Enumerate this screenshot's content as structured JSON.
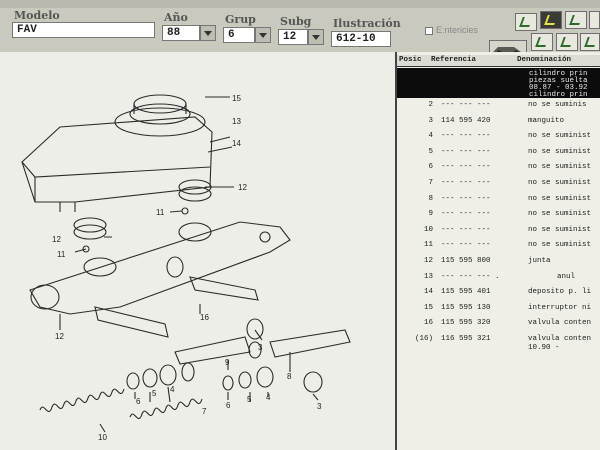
{
  "toolbar": {
    "fields": [
      {
        "key": "modelo",
        "label": "Modelo",
        "value": "FAV"
      },
      {
        "key": "ano",
        "label": "Año",
        "value": "88"
      },
      {
        "key": "grup",
        "label": "Grup",
        "value": "6"
      },
      {
        "key": "subg",
        "label": "Subg",
        "value": "12"
      },
      {
        "key": "ilustracion",
        "label": "Ilustración",
        "value": "612-10"
      }
    ],
    "checkbox_label": "E:ntericies"
  },
  "diagram": {
    "callouts": [
      "15",
      "13",
      "14",
      "12",
      "11",
      "12",
      "11",
      "16",
      "12",
      "9",
      "3",
      "8",
      "7",
      "5",
      "4",
      "6",
      "10",
      "6",
      "5",
      "4",
      "3"
    ]
  },
  "parts_table": {
    "headers": {
      "pos": "Posic",
      "ref": "Referencia",
      "den": "Denominación"
    },
    "highlighted_lines": [
      "cilindro prin",
      "piezas suelta",
      "08.87 - 03.92",
      "cilindro prin"
    ],
    "rows": [
      {
        "pos": "2",
        "ref": "--- --- ---",
        "den": "no se suminis"
      },
      {
        "pos": "3",
        "ref": "114 595 420",
        "den": "manguito"
      },
      {
        "pos": "4",
        "ref": "--- --- ---",
        "den": "no se suminist"
      },
      {
        "pos": "5",
        "ref": "--- --- ---",
        "den": "no se suminist"
      },
      {
        "pos": "6",
        "ref": "--- --- ---",
        "den": "no se suminist"
      },
      {
        "pos": "7",
        "ref": "--- --- ---",
        "den": "no se suminist"
      },
      {
        "pos": "8",
        "ref": "--- --- ---",
        "den": "no se suminist"
      },
      {
        "pos": "9",
        "ref": "--- --- ---",
        "den": "no se suminist"
      },
      {
        "pos": "10",
        "ref": "--- --- ---",
        "den": "no se suminist"
      },
      {
        "pos": "11",
        "ref": "--- --- ---",
        "den": "no se suminist"
      },
      {
        "pos": "12",
        "ref": "115 595 800",
        "den": "junta"
      },
      {
        "pos": "13",
        "ref": "--- --- --- .",
        "den": "anul"
      },
      {
        "pos": "14",
        "ref": "115 595 401",
        "den": "deposito p. li"
      },
      {
        "pos": "15",
        "ref": "115 595 130",
        "den": "interruptor ni"
      },
      {
        "pos": "16",
        "ref": "115 595 320",
        "den": "valvula conten"
      },
      {
        "pos": "(16)",
        "ref": "116 595 321",
        "den": "valvula conten",
        "den2": "10.90 -"
      }
    ]
  }
}
